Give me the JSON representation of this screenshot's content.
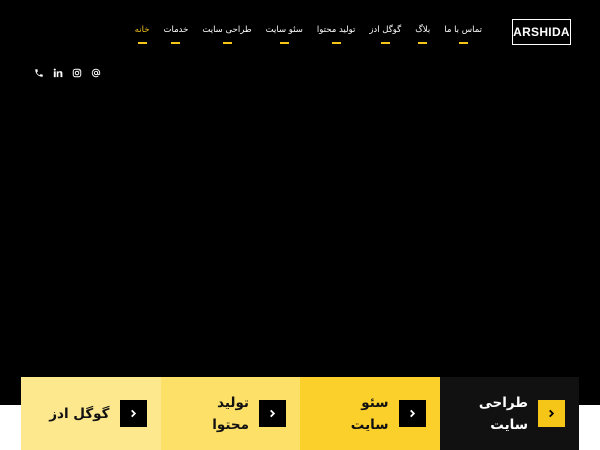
{
  "brand": {
    "logo_text": "ARSHIDA"
  },
  "nav": {
    "items": [
      {
        "label": "خانه",
        "active": true
      },
      {
        "label": "خدمات"
      },
      {
        "label": "طراحی سایت"
      },
      {
        "label": "سئو سایت"
      },
      {
        "label": "تولید محتوا"
      },
      {
        "label": "گوگل ادز"
      },
      {
        "label": "بلاگ"
      },
      {
        "label": "تماس با ما"
      }
    ]
  },
  "social": [
    "phone-icon",
    "linkedin-icon",
    "instagram-icon",
    "email-icon"
  ],
  "services": {
    "cards": [
      {
        "title": "طراحی سایت"
      },
      {
        "title": "سئو سایت"
      },
      {
        "title": "تولید محتوا"
      },
      {
        "title": "گوگل ادز"
      }
    ]
  },
  "colors": {
    "accent": "#f5c518",
    "background": "#000000"
  }
}
